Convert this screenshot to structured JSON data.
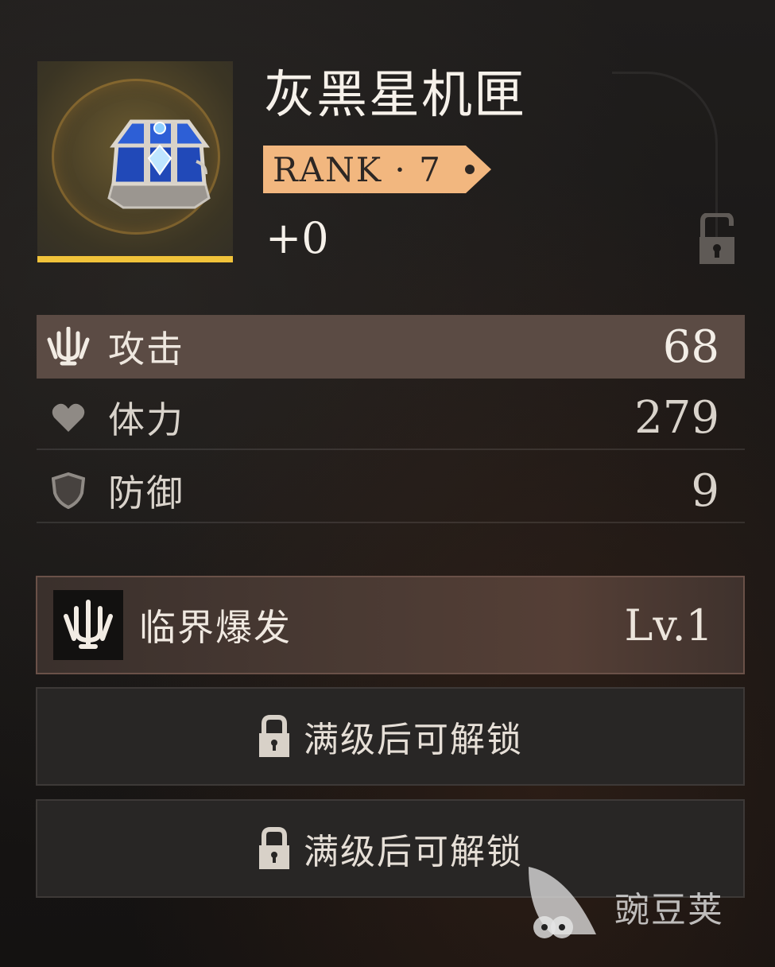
{
  "item": {
    "name": "灰黑星机匣",
    "rank_label": "RANK · 7",
    "enhance_level": "+0",
    "rarity_color": "#f1c33a",
    "icon": "treasure-chest-icon"
  },
  "stats": [
    {
      "label": "攻击",
      "value": "68",
      "icon": "trident-icon"
    },
    {
      "label": "体力",
      "value": "279",
      "icon": "heart-icon"
    },
    {
      "label": "防御",
      "value": "9",
      "icon": "shield-icon"
    }
  ],
  "skill": {
    "name": "临界爆发",
    "level": "Lv.1",
    "icon": "trident-icon"
  },
  "locked_slots": [
    {
      "label": "满级后可解锁",
      "icon": "lock-icon"
    },
    {
      "label": "满级后可解锁",
      "icon": "lock-icon"
    }
  ],
  "watermark": {
    "text": "豌豆荚"
  },
  "colors": {
    "rank_badge": "#f2b77f",
    "active_row": "#5b4b44",
    "background": "#1b1918"
  }
}
